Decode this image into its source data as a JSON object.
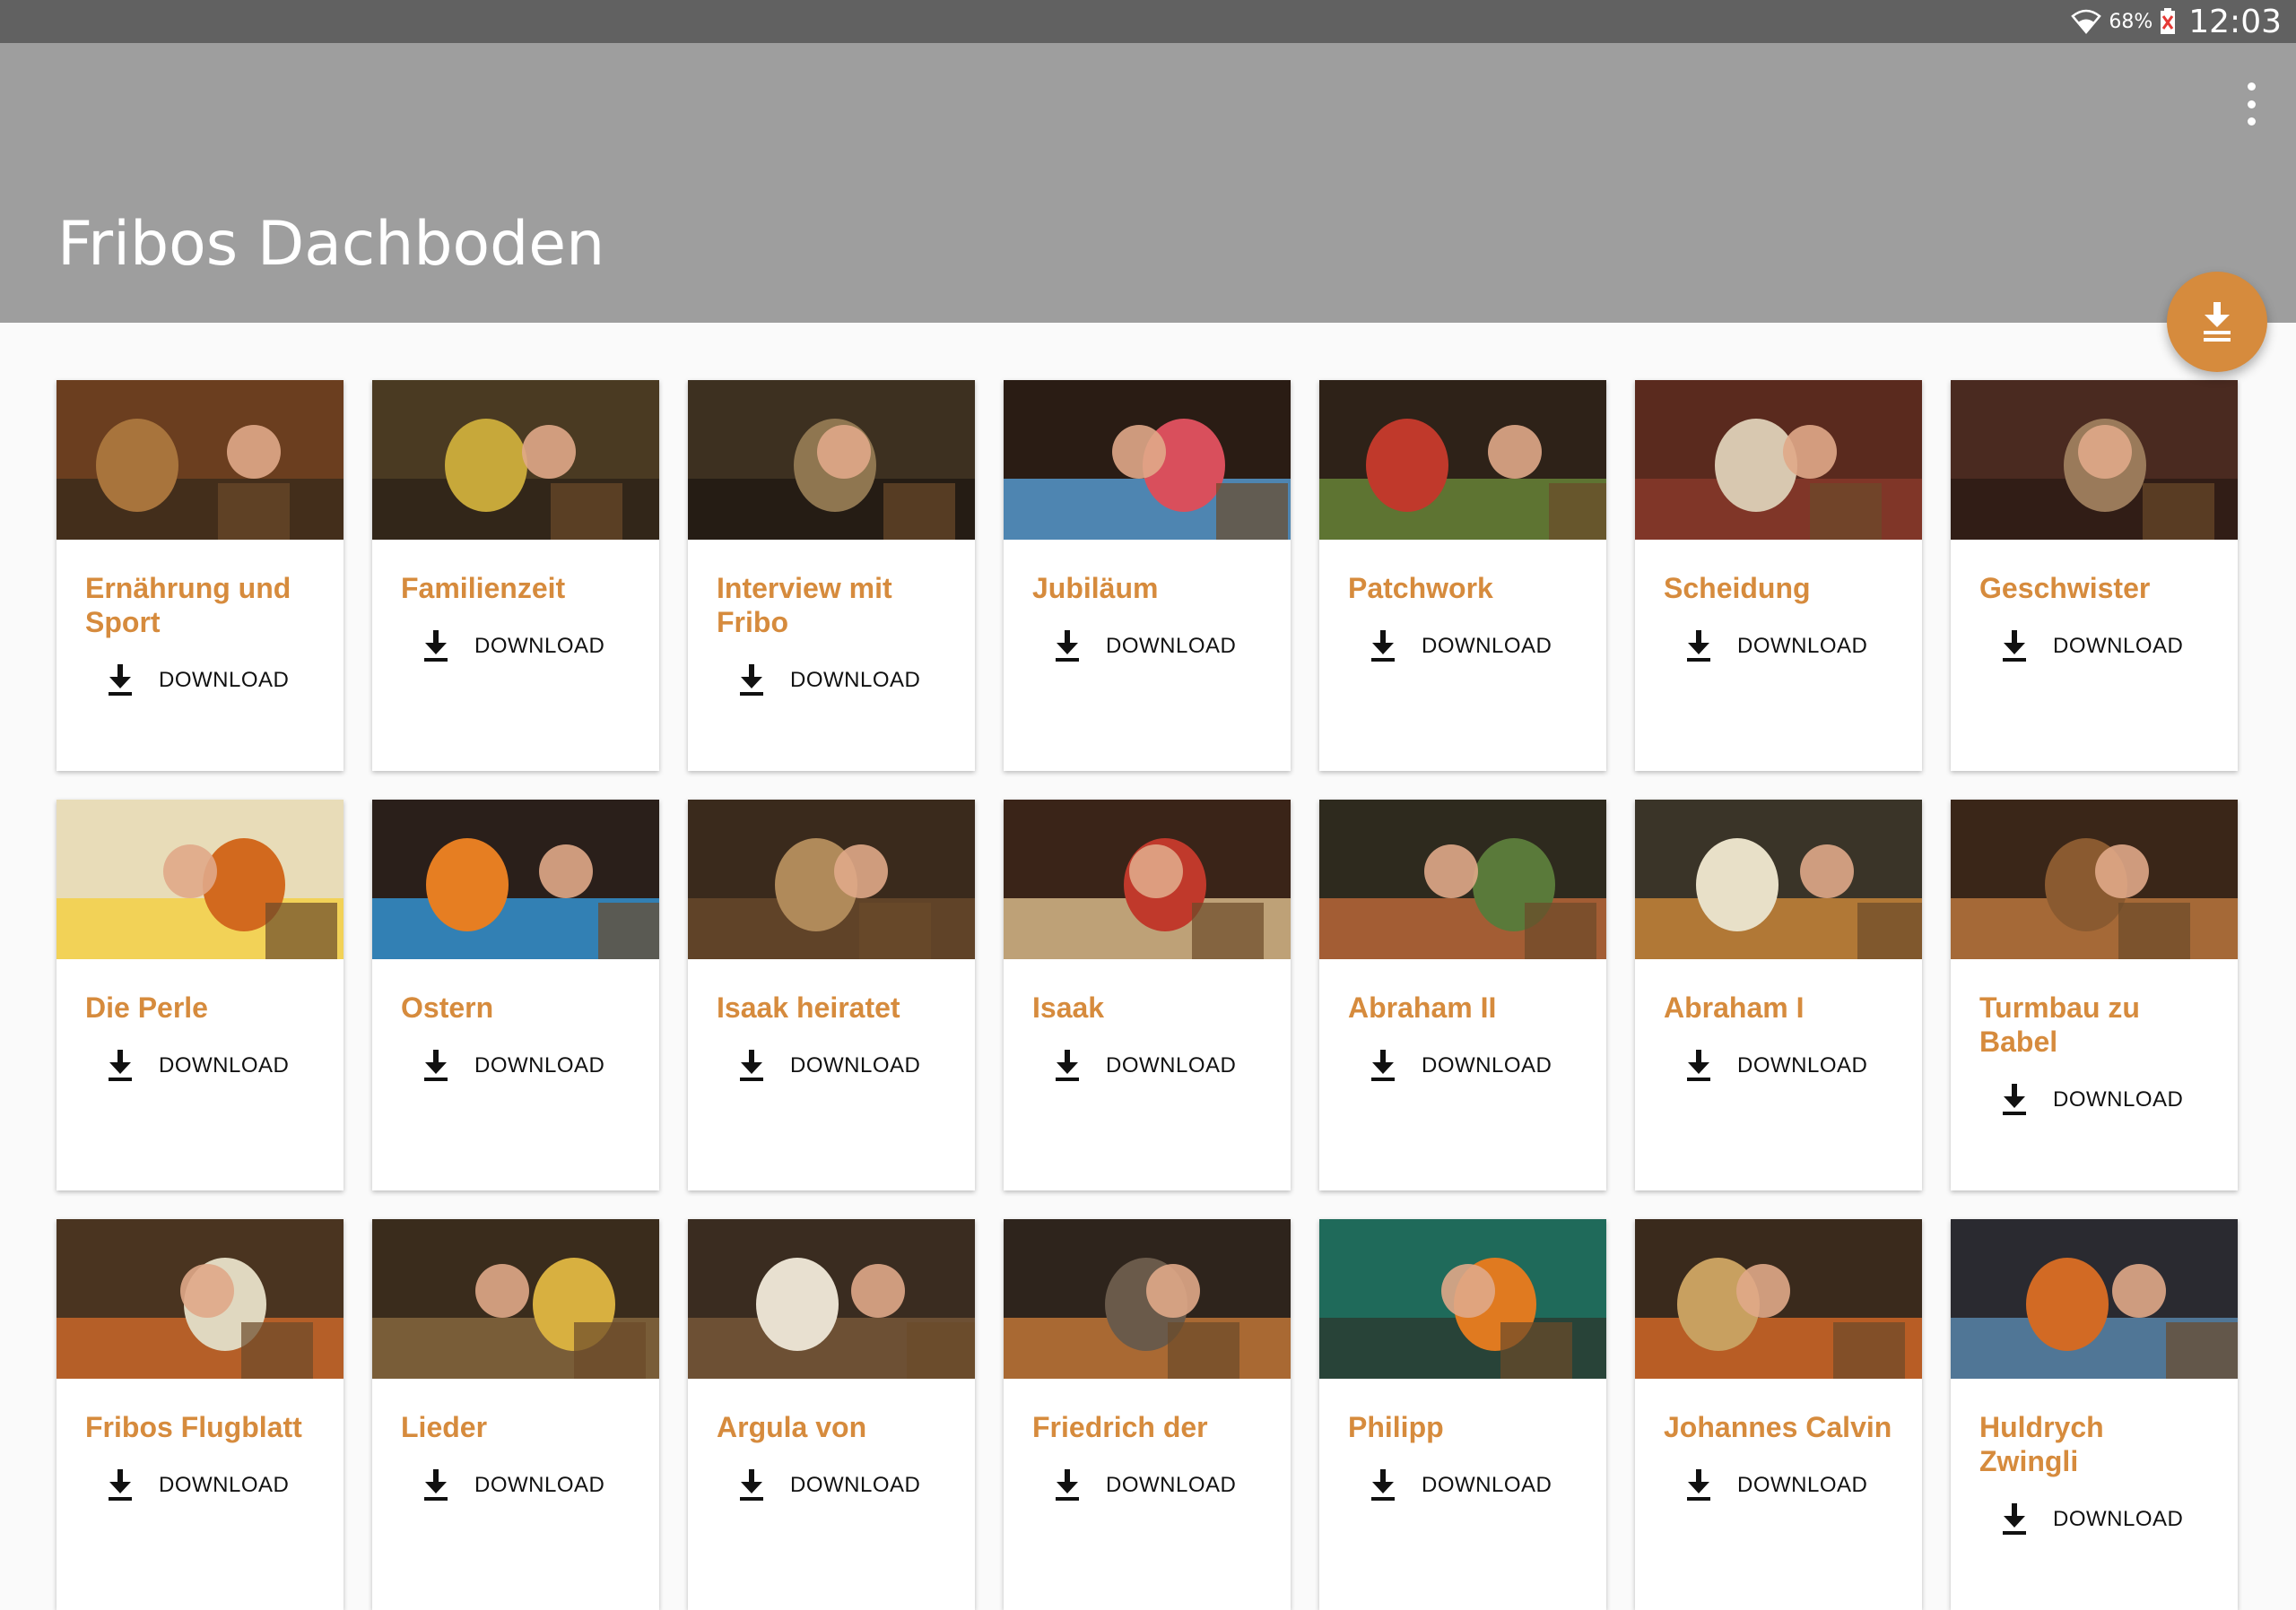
{
  "status_bar": {
    "battery_percent": "68%",
    "time": "12:03",
    "icons": [
      "wifi-icon",
      "battery-icon"
    ]
  },
  "app_bar": {
    "title": "Fribos Dachboden",
    "overflow_icon": "more-vert-icon",
    "bg_color": "#9e9e9e"
  },
  "fab": {
    "icon": "download-all-icon",
    "color": "#d68b3d"
  },
  "accent_color": "#d68b3d",
  "episodes": [
    {
      "title": "Ernährung und Sport",
      "action": "DOWNLOAD"
    },
    {
      "title": "Familienzeit",
      "action": "DOWNLOAD"
    },
    {
      "title": "Interview mit Fribo",
      "action": "DOWNLOAD"
    },
    {
      "title": "Jubiläum",
      "action": "DOWNLOAD"
    },
    {
      "title": "Patchwork",
      "action": "DOWNLOAD"
    },
    {
      "title": "Scheidung",
      "action": "DOWNLOAD"
    },
    {
      "title": "Geschwister",
      "action": "DOWNLOAD"
    },
    {
      "title": "Die Perle",
      "action": "DOWNLOAD"
    },
    {
      "title": "Ostern",
      "action": "DOWNLOAD"
    },
    {
      "title": "Isaak heiratet",
      "action": "DOWNLOAD"
    },
    {
      "title": "Isaak",
      "action": "DOWNLOAD"
    },
    {
      "title": "Abraham II",
      "action": "DOWNLOAD"
    },
    {
      "title": "Abraham I",
      "action": "DOWNLOAD"
    },
    {
      "title": "Turmbau zu Babel",
      "action": "DOWNLOAD"
    },
    {
      "title": "Fribos Flugblatt",
      "action": "DOWNLOAD"
    },
    {
      "title": "Lieder",
      "action": "DOWNLOAD"
    },
    {
      "title": "Argula von",
      "action": "DOWNLOAD"
    },
    {
      "title": "Friedrich der",
      "action": "DOWNLOAD"
    },
    {
      "title": "Philipp",
      "action": "DOWNLOAD"
    },
    {
      "title": "Johannes Calvin",
      "action": "DOWNLOAD"
    },
    {
      "title": "Huldrych Zwingli",
      "action": "DOWNLOAD"
    }
  ]
}
